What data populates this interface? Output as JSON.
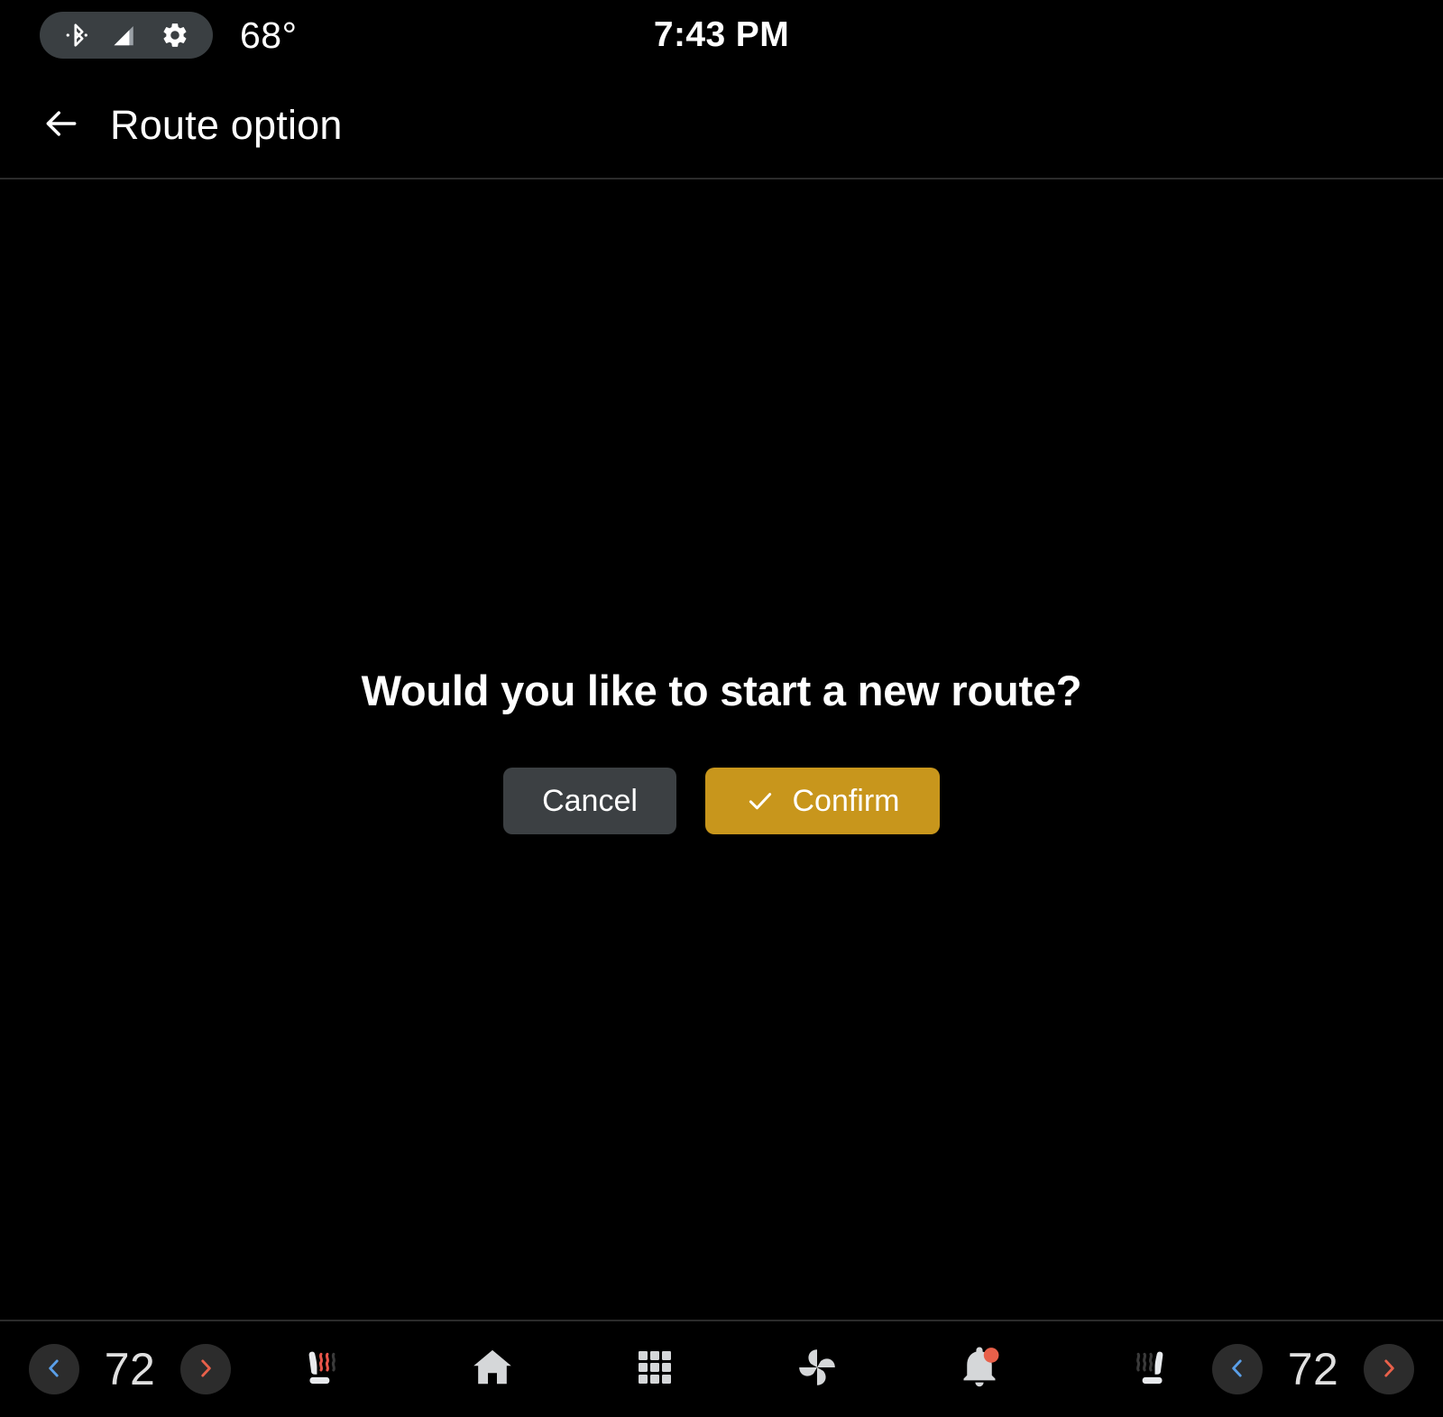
{
  "status_bar": {
    "bluetooth_icon": "bluetooth-icon",
    "signal_icon": "signal-bars-icon",
    "settings_icon": "gear-icon",
    "temperature": "68°",
    "clock": "7:43 PM"
  },
  "app_bar": {
    "back_icon": "back-arrow-icon",
    "title": "Route option"
  },
  "dialog": {
    "message": "Would you like to start a new route?",
    "cancel_label": "Cancel",
    "confirm_label": "Confirm",
    "confirm_icon": "check-icon",
    "confirm_color": "#c8961c",
    "cancel_color": "#3c4043"
  },
  "bottom_bar": {
    "left_climate": {
      "decrease_icon": "chevron-left-icon",
      "temperature": "72",
      "increase_icon": "chevron-right-icon",
      "seat_heater_icon": "heated-seat-icon",
      "seat_heater_level": 2
    },
    "right_climate": {
      "decrease_icon": "chevron-left-icon",
      "temperature": "72",
      "increase_icon": "chevron-right-icon",
      "seat_heater_icon": "heated-seat-icon",
      "seat_heater_level": 0
    },
    "nav_items": [
      {
        "icon": "home-icon",
        "name": "home"
      },
      {
        "icon": "apps-grid-icon",
        "name": "apps"
      },
      {
        "icon": "fan-icon",
        "name": "climate"
      },
      {
        "icon": "bell-icon",
        "name": "notifications",
        "badge": true
      }
    ],
    "colors": {
      "decrease_chevron": "#5a9fe8",
      "increase_chevron": "#e8604a",
      "icon": "#d5d7d9",
      "badge": "#e8604a",
      "heat_active": "#e8554a",
      "heat_inactive": "#3a3a3a"
    }
  }
}
